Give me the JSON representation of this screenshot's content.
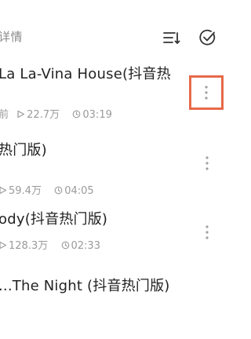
{
  "header": {
    "title": "详情"
  },
  "songs": [
    {
      "title": "La La-Vina House(抖音热",
      "prefix": "前",
      "plays": "22.7万",
      "duration": "03:19"
    },
    {
      "title": "热门版)",
      "prefix": "",
      "plays": "59.4万",
      "duration": "04:05"
    },
    {
      "title": "ody(抖音热门版)",
      "prefix": "",
      "plays": "128.3万",
      "duration": "02:33"
    },
    {
      "title": "...The Night (抖音热门版)",
      "prefix": "",
      "plays": "",
      "duration": ""
    }
  ],
  "colors": {
    "highlight_border": "#e8694a",
    "meta_text": "#9a9a9a",
    "title_text": "#222222"
  },
  "icons": {
    "sort": "sort-list-icon",
    "select": "check-circle-icon",
    "more": "more-vertical-icon",
    "play_count": "play-triangle-icon",
    "duration": "clock-icon"
  }
}
